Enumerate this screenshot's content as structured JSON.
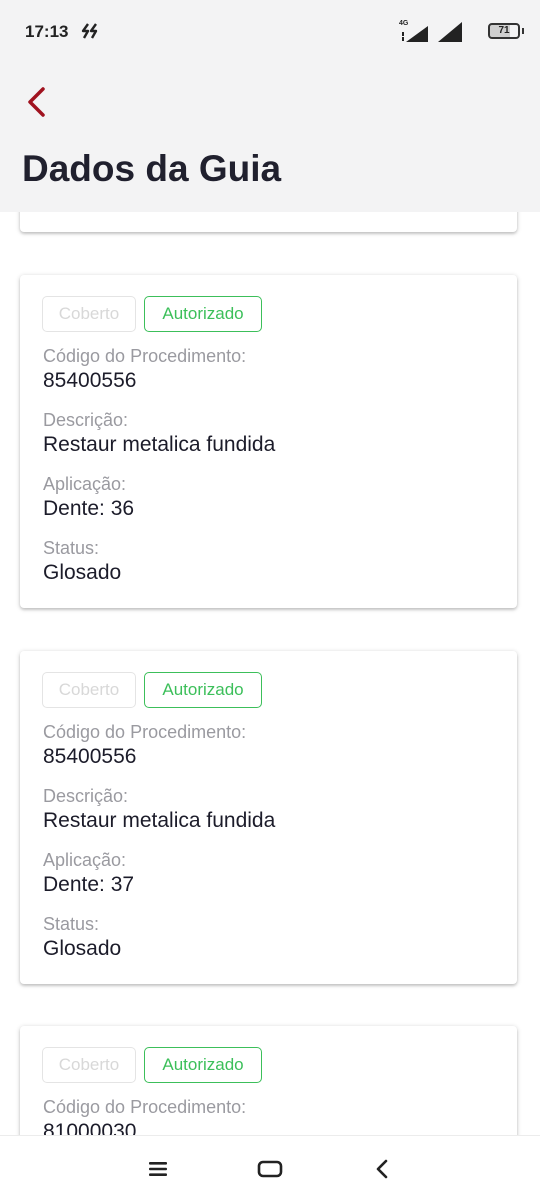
{
  "status_bar": {
    "time": "17:13",
    "network": "4G",
    "battery": "71"
  },
  "header": {
    "title": "Dados da Guia"
  },
  "cards": [
    {
      "badges": {
        "covered": "Coberto",
        "authorized": "Autorizado"
      },
      "fields": [
        {
          "label": "Código do Procedimento:",
          "value": "85400556"
        },
        {
          "label": "Descrição:",
          "value": "Restaur metalica fundida"
        },
        {
          "label": "Aplicação:",
          "value": "Dente: 36"
        },
        {
          "label": "Status:",
          "value": "Glosado"
        }
      ]
    },
    {
      "badges": {
        "covered": "Coberto",
        "authorized": "Autorizado"
      },
      "fields": [
        {
          "label": "Código do Procedimento:",
          "value": "85400556"
        },
        {
          "label": "Descrição:",
          "value": "Restaur metalica fundida"
        },
        {
          "label": "Aplicação:",
          "value": "Dente: 37"
        },
        {
          "label": "Status:",
          "value": "Glosado"
        }
      ]
    },
    {
      "badges": {
        "covered": "Coberto",
        "authorized": "Autorizado"
      },
      "fields": [
        {
          "label": "Código do Procedimento:",
          "value": "81000030"
        }
      ]
    }
  ],
  "colors": {
    "accent_back": "#a0121f",
    "authorized_green": "#3cbf5a"
  }
}
